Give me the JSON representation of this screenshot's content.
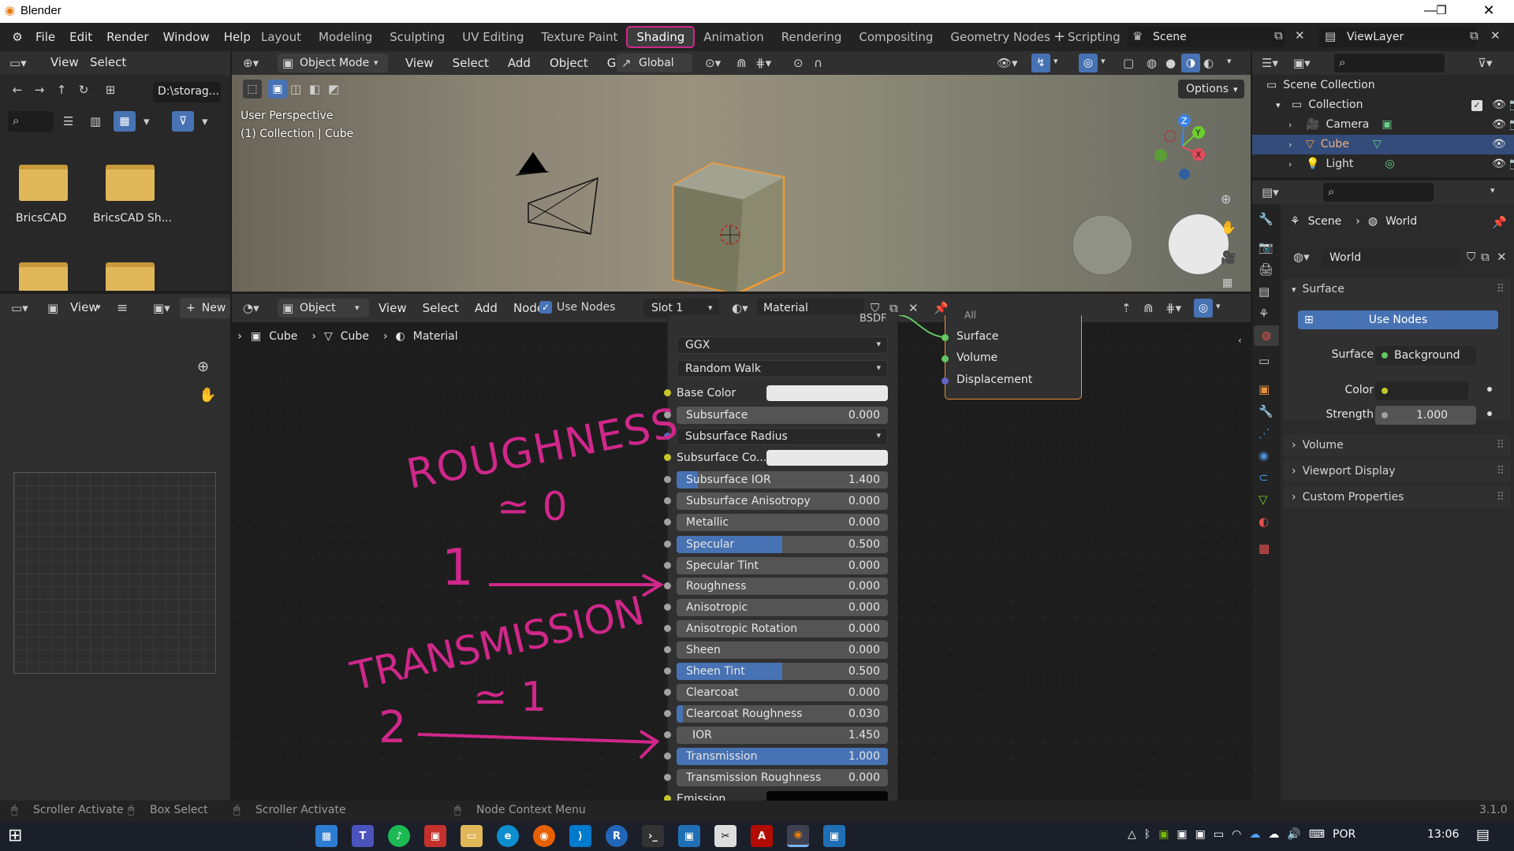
{
  "window": {
    "title": "Blender",
    "version": "3.1.0"
  },
  "menu": [
    "File",
    "Edit",
    "Render",
    "Window",
    "Help"
  ],
  "workspaces": [
    "Layout",
    "Modeling",
    "Sculpting",
    "UV Editing",
    "Texture Paint",
    "Shading",
    "Animation",
    "Rendering",
    "Compositing",
    "Geometry Nodes",
    "Scripting"
  ],
  "active_workspace": "Shading",
  "scene": {
    "name": "Scene",
    "view_layer": "ViewLayer"
  },
  "file_browser": {
    "menu": [
      "View",
      "Select"
    ],
    "path": "D:\\storag...",
    "items": [
      "BricsCAD",
      "BricsCAD Sh..."
    ]
  },
  "image_editor": {
    "view": "View",
    "new": "New"
  },
  "viewport": {
    "mode": "Object Mode",
    "menu": [
      "View",
      "Select",
      "Add",
      "Object",
      "GIS"
    ],
    "transform": "Global",
    "options": "Options",
    "overlay_line1": "User Perspective",
    "overlay_line2": "(1) Collection | Cube",
    "gizmo": {
      "x": "X",
      "y": "Y",
      "z": "Z"
    }
  },
  "node_editor": {
    "type": "Object",
    "menu": [
      "View",
      "Select",
      "Add",
      "Node"
    ],
    "use_nodes": "Use Nodes",
    "slot": "Slot 1",
    "material": "Material",
    "breadcrumb": [
      "Cube",
      "Cube",
      "Material"
    ],
    "bsdf_header_fragment": "BSDF",
    "output_fragment": "All",
    "distribution": "GGX",
    "subsurface_method": "Random Walk",
    "inputs": [
      {
        "label": "Base Color",
        "kind": "color"
      },
      {
        "label": "Subsurface",
        "value": "0.000",
        "fill": 0
      },
      {
        "label": "Subsurface Radius",
        "kind": "dropdown"
      },
      {
        "label": "Subsurface Co...",
        "kind": "color"
      },
      {
        "label": "Subsurface IOR",
        "value": "1.400",
        "fill": 0.1
      },
      {
        "label": "Subsurface Anisotropy",
        "value": "0.000",
        "fill": 0
      },
      {
        "label": "Metallic",
        "value": "0.000",
        "fill": 0
      },
      {
        "label": "Specular",
        "value": "0.500",
        "fill": 0.5
      },
      {
        "label": "Specular Tint",
        "value": "0.000",
        "fill": 0
      },
      {
        "label": "Roughness",
        "value": "0.000",
        "fill": 0
      },
      {
        "label": "Anisotropic",
        "value": "0.000",
        "fill": 0
      },
      {
        "label": "Anisotropic Rotation",
        "value": "0.000",
        "fill": 0
      },
      {
        "label": "Sheen",
        "value": "0.000",
        "fill": 0
      },
      {
        "label": "Sheen Tint",
        "value": "0.500",
        "fill": 0.5
      },
      {
        "label": "Clearcoat",
        "value": "0.000",
        "fill": 0
      },
      {
        "label": "Clearcoat Roughness",
        "value": "0.030",
        "fill": 0.03
      },
      {
        "label": "IOR",
        "value": "1.450",
        "fill": 0
      },
      {
        "label": "Transmission",
        "value": "1.000",
        "fill": 1
      },
      {
        "label": "Transmission Roughness",
        "value": "0.000",
        "fill": 0
      },
      {
        "label": "Emission",
        "kind": "color"
      }
    ],
    "output_sockets": [
      "Surface",
      "Volume",
      "Displacement"
    ]
  },
  "annotations": {
    "roughness": "ROUGHNESS",
    "roughness_approx": "≃ 0",
    "step1": "1",
    "transmission": "TRANSMISSION",
    "transmission_approx": "≃ 1",
    "step2": "2"
  },
  "outliner": {
    "scene_collection": "Scene Collection",
    "items": [
      "Collection",
      "Camera",
      "Cube",
      "Light"
    ]
  },
  "properties": {
    "breadcrumb": [
      "Scene",
      "World"
    ],
    "world_name": "World",
    "surface_panel": "Surface",
    "use_nodes": "Use Nodes",
    "surface_label": "Surface",
    "surface_value": "Background",
    "color_label": "Color",
    "strength_label": "Strength",
    "strength_value": "1.000",
    "panels": [
      "Volume",
      "Viewport Display",
      "Custom Properties"
    ]
  },
  "status_bar": [
    "Scroller Activate",
    "Box Select",
    "Scroller Activate",
    "Node Context Menu"
  ],
  "taskbar": {
    "lang": "POR",
    "time": "13:06"
  },
  "colors": {
    "accent": "#4772b3",
    "annotation": "#d0278a",
    "selected": "#e8923d"
  }
}
